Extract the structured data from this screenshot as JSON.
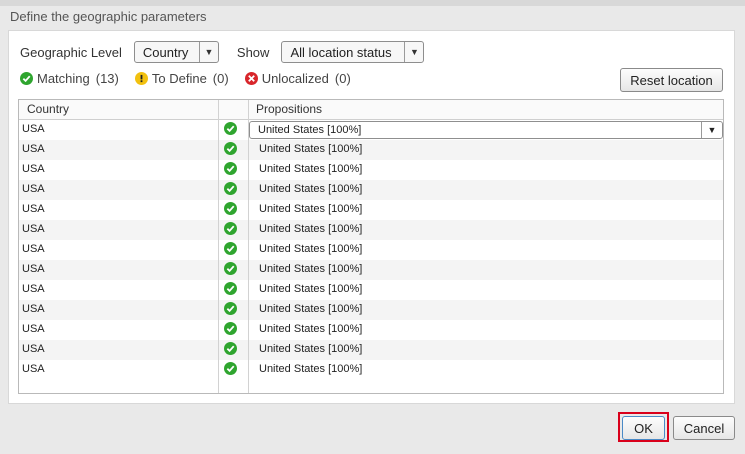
{
  "dialog": {
    "title": "Define the geographic parameters",
    "geo_level_label": "Geographic Level",
    "geo_level_value": "Country",
    "show_label": "Show",
    "show_value": "All location status",
    "status": {
      "matching_label": "Matching",
      "matching_count": "(13)",
      "to_define_label": "To Define",
      "to_define_count": "(0)",
      "unlocalized_label": "Unlocalized",
      "unlocalized_count": "(0)"
    },
    "reset_button": "Reset location",
    "table": {
      "headers": {
        "country": "Country",
        "propositions": "Propositions"
      },
      "rows": [
        {
          "country": "USA",
          "proposition": "United States  [100%]",
          "status": "check-icon"
        },
        {
          "country": "USA",
          "proposition": "United States  [100%]",
          "status": "check-icon"
        },
        {
          "country": "USA",
          "proposition": "United States  [100%]",
          "status": "check-icon"
        },
        {
          "country": "USA",
          "proposition": "United States  [100%]",
          "status": "check-icon"
        },
        {
          "country": "USA",
          "proposition": "United States  [100%]",
          "status": "check-icon"
        },
        {
          "country": "USA",
          "proposition": "United States  [100%]",
          "status": "check-icon"
        },
        {
          "country": "USA",
          "proposition": "United States  [100%]",
          "status": "check-icon"
        },
        {
          "country": "USA",
          "proposition": "United States  [100%]",
          "status": "check-icon"
        },
        {
          "country": "USA",
          "proposition": "United States  [100%]",
          "status": "check-icon"
        },
        {
          "country": "USA",
          "proposition": "United States  [100%]",
          "status": "check-icon"
        },
        {
          "country": "USA",
          "proposition": "United States  [100%]",
          "status": "check-icon"
        },
        {
          "country": "USA",
          "proposition": "United States  [100%]",
          "status": "check-icon"
        },
        {
          "country": "USA",
          "proposition": "United States  [100%]",
          "status": "check-icon"
        }
      ]
    },
    "ok_button": "OK",
    "cancel_button": "Cancel"
  },
  "colors": {
    "match_green": "#2fa52f",
    "define_yellow": "#f2c10f",
    "unloc_red": "#d8262b",
    "highlight_red": "#d9001b"
  }
}
